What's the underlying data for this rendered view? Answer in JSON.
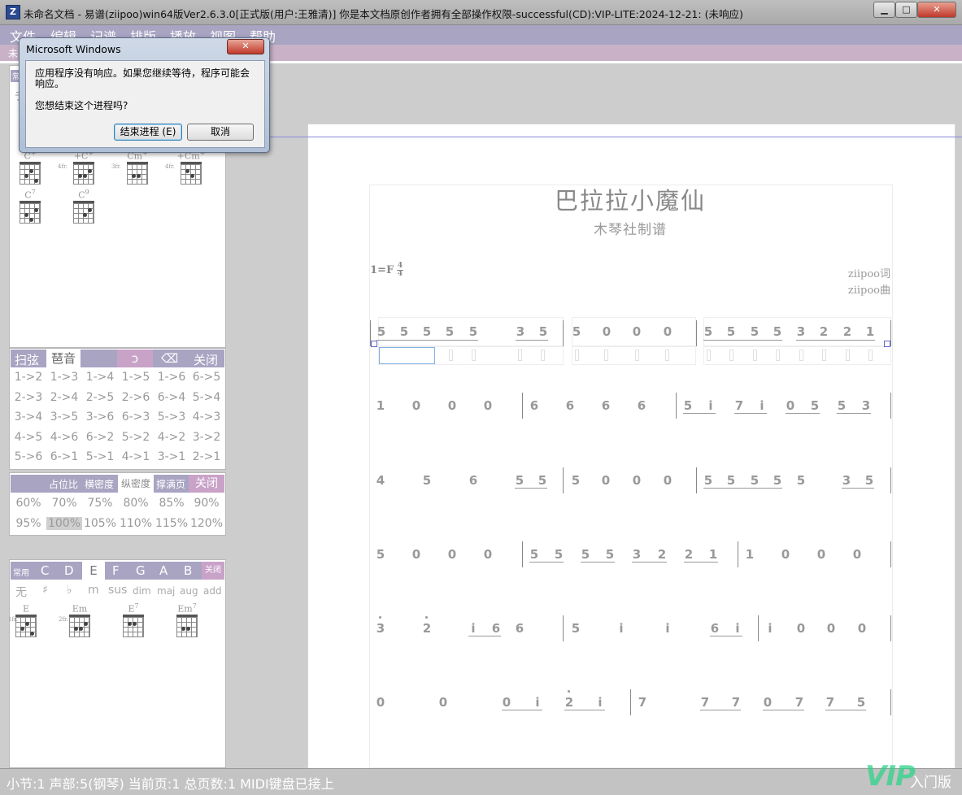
{
  "window": {
    "title": "未命名文档 - 易谱(ziipoo)win64版Ver2.6.3.0[正式版(用户:王雅清)] 你是本文档原创作者拥有全部操作权限-successful(CD):VIP-LITE:2024-12-21: (未响应)",
    "app_icon": "Z",
    "minimize": "▁",
    "maximize": "□",
    "close": "✕"
  },
  "menu": [
    "文件",
    "编辑",
    "记谱",
    "排版",
    "播放",
    "视图",
    "帮助"
  ],
  "subbar_tab": "未",
  "chord_panel_top": {
    "tab": "常",
    "stub": "ラ",
    "chords": [
      {
        "name": "C",
        "sup": "+",
        "fret": ""
      },
      {
        "name": "+C",
        "sup": "+",
        "fret": "4fr."
      },
      {
        "name": "Cm",
        "sup": "+",
        "fret": "3fr."
      },
      {
        "name": "+Cm",
        "sup": "+",
        "fret": "4fr."
      },
      {
        "name": "C",
        "sup": "7",
        "fret": ""
      },
      {
        "name": "C",
        "sup": "9",
        "fret": ""
      }
    ]
  },
  "strum_panel": {
    "tabs": [
      "扫弦",
      "琶音",
      "",
      "ↄ",
      "⌫",
      "关闭"
    ],
    "rows": [
      [
        "1->2",
        "1->3",
        "1->4",
        "1->5",
        "1->6",
        "6->5"
      ],
      [
        "2->3",
        "2->4",
        "2->5",
        "2->6",
        "6->4",
        "5->4"
      ],
      [
        "3->4",
        "3->5",
        "3->6",
        "6->3",
        "5->3",
        "4->3"
      ],
      [
        "4->5",
        "4->6",
        "6->2",
        "5->2",
        "4->2",
        "3->2"
      ],
      [
        "5->6",
        "6->1",
        "5->1",
        "4->1",
        "3->1",
        "2->1"
      ]
    ]
  },
  "ratio_panel": {
    "tabs": [
      "占位比",
      "横密度",
      "纵密度",
      "撑满页",
      "关闭"
    ],
    "rows": [
      [
        "60%",
        "70%",
        "75%",
        "80%",
        "85%",
        "90%"
      ],
      [
        "95%",
        "100%",
        "105%",
        "110%",
        "115%",
        "120%"
      ]
    ],
    "selected": "100%"
  },
  "key_panel": {
    "tabs": [
      "常用",
      "C",
      "D",
      "E",
      "F",
      "G",
      "A",
      "B",
      "关闭"
    ],
    "active_key": "E",
    "qualities": [
      "无",
      "♯",
      "♭",
      "m",
      "sus",
      "dim",
      "maj",
      "aug",
      "add"
    ],
    "chords": [
      {
        "name": "E",
        "sup": "",
        "fret": "1fr."
      },
      {
        "name": "Em",
        "sup": "",
        "fret": "2fr."
      },
      {
        "name": "E",
        "sup": "7",
        "fret": ""
      },
      {
        "name": "Em",
        "sup": "7",
        "fret": ""
      }
    ]
  },
  "score": {
    "title": "巴拉拉小魔仙",
    "subtitle": "木琴社制谱",
    "key": "1=F",
    "time_top": "4",
    "time_bottom": "4",
    "lyricist": "ziipoo词",
    "composer": "ziipoo曲",
    "rows": [
      [
        "5",
        "5",
        "5",
        "5",
        "5",
        "3",
        "5",
        "5",
        "0",
        "0",
        "0",
        "5",
        "5",
        "5",
        "5",
        "3",
        "2",
        "2",
        "1"
      ],
      [
        "1",
        "0",
        "0",
        "0",
        "6",
        "6",
        "6",
        "6",
        "5",
        "i",
        "7",
        "i",
        "0",
        "5",
        "5",
        "3"
      ],
      [
        "4",
        "5",
        "6",
        "5",
        "5",
        "5",
        "0",
        "0",
        "0",
        "5",
        "5",
        "5",
        "5",
        "5",
        "3",
        "5"
      ],
      [
        "5",
        "0",
        "0",
        "0",
        "5",
        "5",
        "5",
        "5",
        "3",
        "2",
        "2",
        "1",
        "1",
        "0",
        "0",
        "0"
      ],
      [
        "3",
        "2",
        "i",
        "6",
        "6",
        "5",
        "i",
        "i",
        "6",
        "i",
        "i",
        "0",
        "0",
        "0"
      ],
      [
        "0",
        "0",
        "0",
        "i",
        "2",
        "i",
        "7",
        "7",
        "7",
        "0",
        "7",
        "7",
        "5"
      ]
    ]
  },
  "status": {
    "text": "小节:1 声部:5(钢琴) 当前页:1 总页数:1 MIDI键盘已接上",
    "logo": "VIP",
    "edition": "入门版"
  },
  "dialog": {
    "title": "Microsoft Windows",
    "close": "✕",
    "message": "应用程序没有响应。如果您继续等待，程序可能会响应。",
    "question": "您想结束这个进程吗?",
    "end_button": "结束进程 (E)",
    "cancel_button": "取消"
  }
}
